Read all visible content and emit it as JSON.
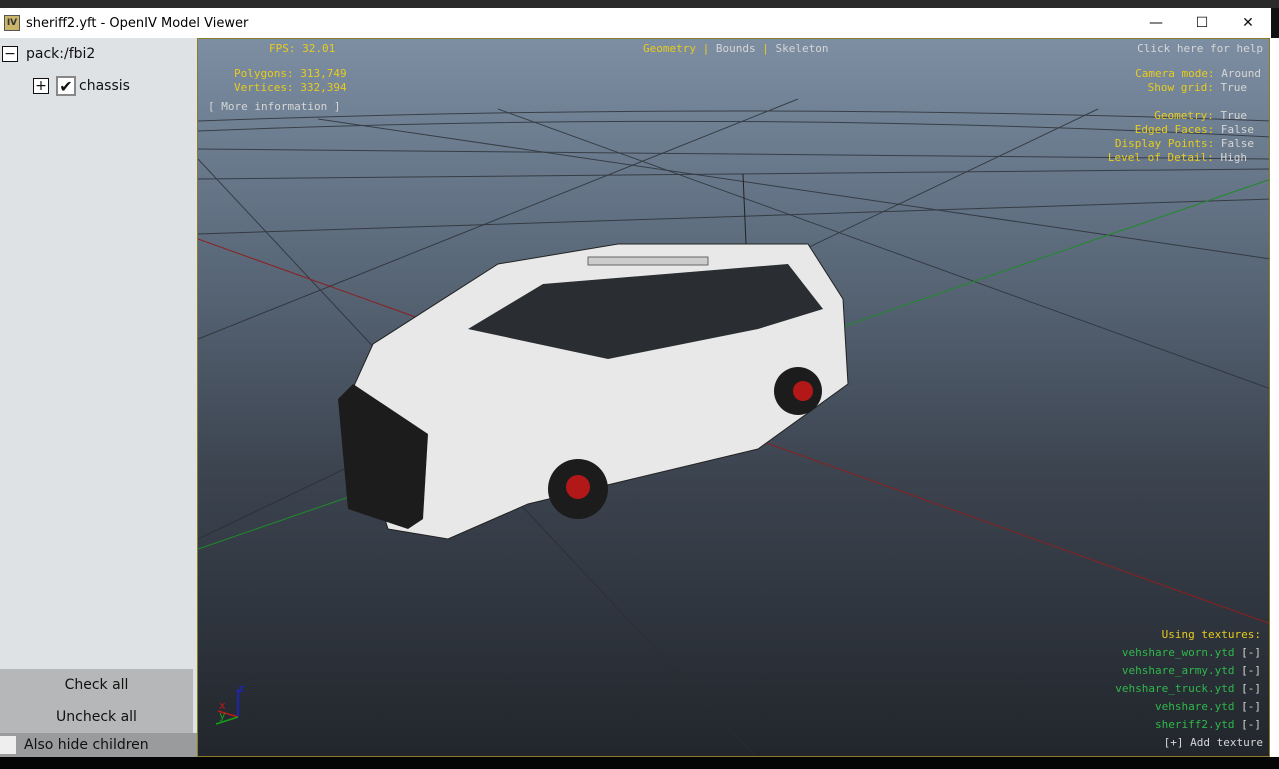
{
  "window": {
    "title": "sheriff2.yft - OpenIV Model Viewer",
    "icon": "IV",
    "minimize": "—",
    "maximize": "☐",
    "close": "✕"
  },
  "tree": {
    "root": {
      "label": "pack:/fbi2",
      "expander": "−"
    },
    "child": {
      "label": "chassis",
      "expander": "+",
      "checked": true,
      "check": "✔"
    }
  },
  "left_buttons": {
    "check_all": "Check all",
    "uncheck_all": "Uncheck all",
    "also_hide_children": "Also hide children"
  },
  "overlay": {
    "fps_label": "FPS:",
    "fps": "32.01",
    "polygons_label": "Polygons:",
    "polygons": "313,749",
    "vertices_label": "Vertices:",
    "vertices": "332,394",
    "more_info": "[ More information ]",
    "modes": [
      "Geometry",
      "Bounds",
      "Skeleton"
    ],
    "mode_sep": "|",
    "help": "Click here for help",
    "settings": [
      {
        "label": "Camera mode:",
        "value": "Around"
      },
      {
        "label": "Show grid:",
        "value": "True"
      },
      {
        "label": "Geometry:",
        "value": "True"
      },
      {
        "label": "Edged Faces:",
        "value": "False"
      },
      {
        "label": "Display Points:",
        "value": "False"
      },
      {
        "label": "Level of Detail:",
        "value": "High"
      }
    ],
    "textures_title": "Using textures:",
    "textures": [
      "vehshare_worn.ytd",
      "vehshare_army.ytd",
      "vehshare_truck.ytd",
      "vehshare.ytd",
      "sheriff2.ytd"
    ],
    "remove": "[-]",
    "add_texture": "[+] Add texture",
    "axes": {
      "x": "x",
      "y": "y",
      "z": "z"
    }
  },
  "colors": {
    "accent_yellow": "#e8cc1c",
    "texture_green": "#2fb84a"
  }
}
